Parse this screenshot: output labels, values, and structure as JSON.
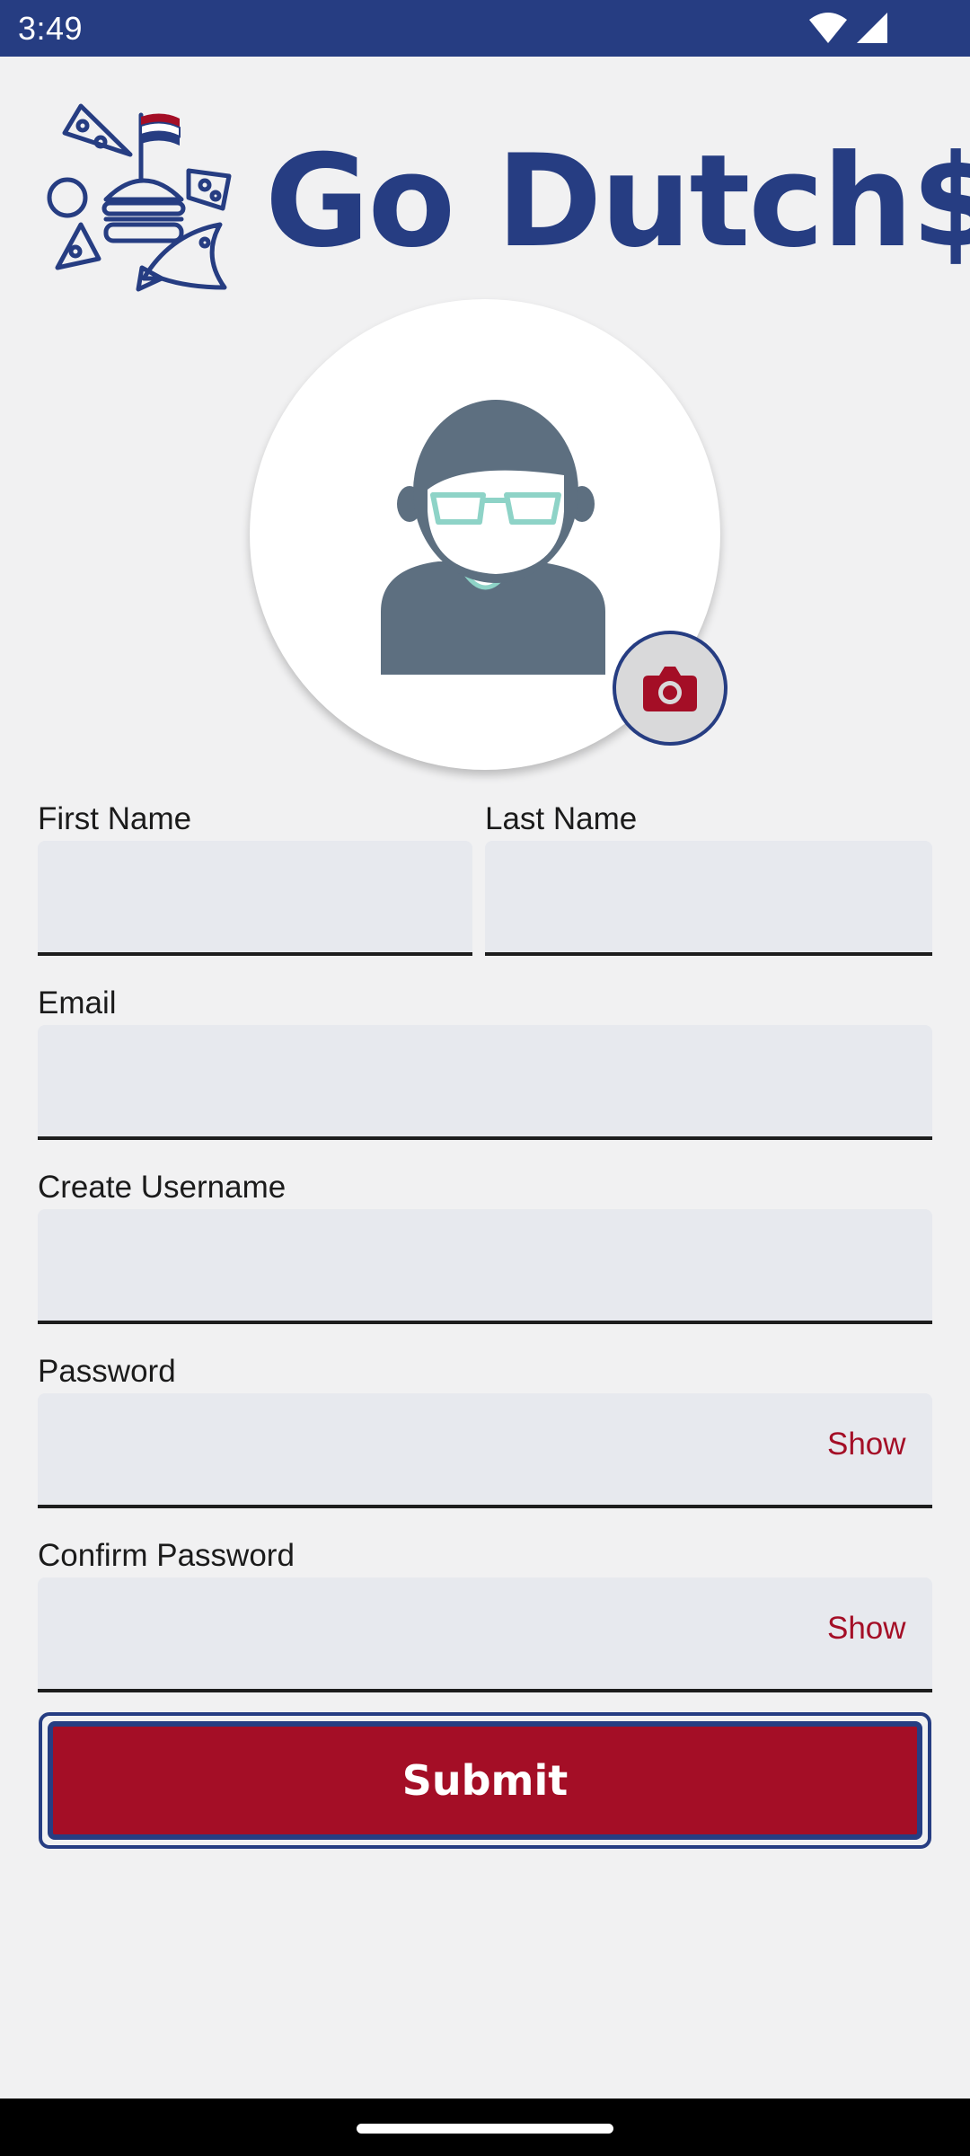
{
  "status_bar": {
    "time": "3:49",
    "icons": [
      "wifi-icon",
      "cellular-signal-icon"
    ]
  },
  "app": {
    "logo_text": "Go Dutch$"
  },
  "avatar": {
    "icon": "person-with-glasses-icon",
    "camera_icon": "camera-icon"
  },
  "form": {
    "first_name": {
      "label": "First Name",
      "value": ""
    },
    "last_name": {
      "label": "Last Name",
      "value": ""
    },
    "email": {
      "label": "Email",
      "value": ""
    },
    "username": {
      "label": "Create Username",
      "value": ""
    },
    "password": {
      "label": "Password",
      "value": "",
      "toggle": "Show"
    },
    "confirm_password": {
      "label": "Confirm Password",
      "value": "",
      "toggle": "Show"
    },
    "submit_label": "Submit"
  },
  "colors": {
    "brand_navy": "#263d82",
    "brand_red": "#a40e26",
    "input_background": "#e7e9ee",
    "page_background": "#f1f1f2",
    "avatar_gray": "#5d6f80",
    "glasses_mint": "#8ed3c7"
  }
}
